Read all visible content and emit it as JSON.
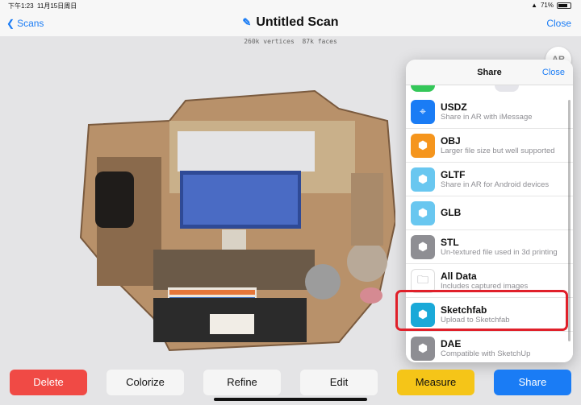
{
  "status_bar": {
    "time": "下午1:23",
    "date": "11月15日周日",
    "battery": "71%"
  },
  "nav": {
    "back_label": "Scans",
    "title": "Untitled Scan",
    "close_label": "Close"
  },
  "stats": "260k vertices  87k faces",
  "ar_label": "AR",
  "share_sheet": {
    "title": "Share",
    "close_label": "Close",
    "items": [
      {
        "title": "USDZ",
        "subtitle": "Share in AR with iMessage",
        "color": "#1a7cf5",
        "icon": "ar-target-icon"
      },
      {
        "title": "OBJ",
        "subtitle": "Larger file size but well supported",
        "color": "#f5951d",
        "icon": "cube-icon"
      },
      {
        "title": "GLTF",
        "subtitle": "Share in AR for Android devices",
        "color": "#69c7f0",
        "icon": "cube-icon"
      },
      {
        "title": "GLB",
        "subtitle": "",
        "color": "#69c7f0",
        "icon": "cube-icon"
      },
      {
        "title": "STL",
        "subtitle": "Un-textured file used in 3d printing",
        "color": "#8e8e93",
        "icon": "cube-icon"
      },
      {
        "title": "All Data",
        "subtitle": "Includes captured images",
        "color": "#ffffff",
        "icon": "folder-icon"
      },
      {
        "title": "Sketchfab",
        "subtitle": "Upload to Sketchfab",
        "color": "#1aa9d8",
        "icon": "cube-icon"
      },
      {
        "title": "DAE",
        "subtitle": "Compatible with SketchUp",
        "color": "#8e8e93",
        "icon": "cube-icon"
      }
    ]
  },
  "buttons": {
    "delete": "Delete",
    "colorize": "Colorize",
    "refine": "Refine",
    "edit": "Edit",
    "measure": "Measure",
    "share": "Share"
  },
  "colors": {
    "accent": "#1a7cf5",
    "delete": "#f04a45",
    "measure": "#f5c518",
    "share": "#1a7cf5",
    "highlight": "#e0202a"
  }
}
